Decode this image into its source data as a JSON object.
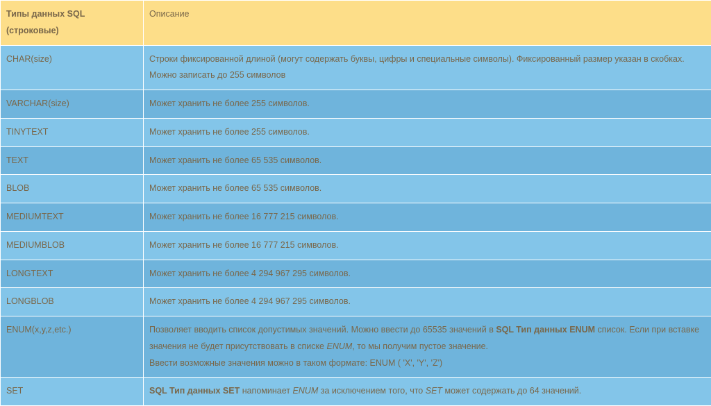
{
  "header": {
    "col_type": "Типы данных SQL (строковые)",
    "col_desc": "Описание"
  },
  "rows": [
    {
      "band": "a",
      "type": "CHAR(size)",
      "desc": "Строки фиксированной длиной (могут содержать буквы, цифры и специальные символы). Фиксированный размер указан в скобках. Можно записать до 255 символов"
    },
    {
      "band": "b",
      "type": "VARCHAR(size)",
      "desc": "Может хранить не более 255 символов."
    },
    {
      "band": "a",
      "type": "TINYTEXT",
      "desc": "Может хранить не более 255 символов."
    },
    {
      "band": "b",
      "type": "TEXT",
      "desc": "Может хранить не более 65 535 символов."
    },
    {
      "band": "a",
      "type": "BLOB",
      "desc": "Может хранить не более 65 535 символов."
    },
    {
      "band": "b",
      "type": "MEDIUMTEXT",
      "desc": "Может хранить не более 16 777 215 символов."
    },
    {
      "band": "a",
      "type": "MEDIUMBLOB",
      "desc": "Может хранить не более 16 777 215 символов."
    },
    {
      "band": "b",
      "type": "LONGTEXT",
      "desc": "Может хранить не более 4 294 967 295 символов."
    },
    {
      "band": "a",
      "type": "LONGBLOB",
      "desc": "Может хранить не более 4 294 967 295 символов."
    },
    {
      "band": "b",
      "type": "ENUM(x,y,z,etc.)",
      "desc_html": "Позволяет вводить список допустимых значений. Можно ввести до 65535 значений в <b>SQL Тип данных ENUM</b> список. Если при вставке значения не будет присутствовать в списке <i>ENUM</i>, то мы получим пустое значение.<br>Ввести возможные значения можно в таком формате: ENUM ( 'X', 'Y', 'Z')"
    },
    {
      "band": "a",
      "type": "SET",
      "desc_html": "<b>SQL Тип данных SET</b> напоминает <i>ENUM</i> за исключением того, что <i>SET</i> может содержать до 64 значений."
    }
  ]
}
